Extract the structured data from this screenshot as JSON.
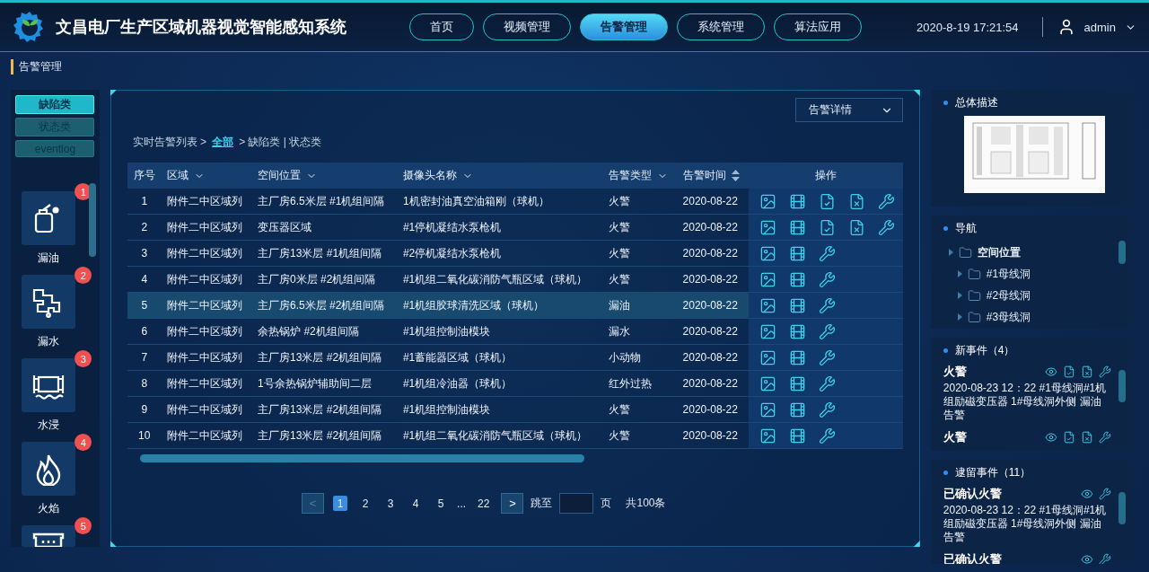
{
  "header": {
    "title": "文昌电厂生产区域机器视觉智能感知系统",
    "nav": [
      {
        "label": "首页",
        "selected": false
      },
      {
        "label": "视频管理",
        "selected": false
      },
      {
        "label": "告警管理",
        "selected": true
      },
      {
        "label": "系统管理",
        "selected": false
      },
      {
        "label": "算法应用",
        "selected": false
      }
    ],
    "datetime": "2020-8-19  17:21:54",
    "user": "admin"
  },
  "page_title": "告警管理",
  "sidebar": {
    "tabs": [
      {
        "label": "缺陷类",
        "selected": true
      },
      {
        "label": "状态类",
        "selected": false
      },
      {
        "label": "eventlog",
        "selected": false
      }
    ],
    "categories": [
      {
        "label": "漏油",
        "badge": "1"
      },
      {
        "label": "漏水",
        "badge": "2"
      },
      {
        "label": "水浸",
        "badge": "3"
      },
      {
        "label": "火焰",
        "badge": "4"
      },
      {
        "badge": "5"
      }
    ]
  },
  "main": {
    "detail_select": "告警详情",
    "breadcrumb": {
      "root": "实时告警列表 >",
      "current": "全部",
      "rest": "> 缺陷类 | 状态类"
    },
    "table": {
      "columns": [
        {
          "label": "序号",
          "kind": "plain"
        },
        {
          "label": "区域",
          "kind": "filter"
        },
        {
          "label": "空间位置",
          "kind": "filter"
        },
        {
          "label": "摄像头名称",
          "kind": "filter"
        },
        {
          "label": "告警类型",
          "kind": "filter"
        },
        {
          "label": "告警时间",
          "kind": "sort"
        },
        {
          "label": "操作",
          "kind": "plain"
        }
      ],
      "rows": [
        {
          "cells": [
            "1",
            "附件二中区域列",
            "主厂房6.5米层 #1机组间隔",
            "1机密封油真空油箱刚（球机）",
            "火警",
            "2020-08-22"
          ],
          "review_actions": true,
          "selected": false
        },
        {
          "cells": [
            "2",
            "附件二中区域列",
            "变压器区域",
            "#1停机凝结水泵枪机",
            "火警",
            "2020-08-22"
          ],
          "review_actions": true,
          "selected": false
        },
        {
          "cells": [
            "3",
            "附件二中区域列",
            "主厂房13米层 #1机组间隔",
            "#2停机凝结水泵枪机",
            "火警",
            "2020-08-22"
          ],
          "review_actions": false,
          "selected": false
        },
        {
          "cells": [
            "4",
            "附件二中区域列",
            "主厂房0米层 #2机组间隔",
            "#1机组二氧化碳消防气瓶区域（球机）",
            "火警",
            "2020-08-22"
          ],
          "review_actions": false,
          "selected": false
        },
        {
          "cells": [
            "5",
            "附件二中区域列",
            "主厂房6.5米层 #2机组间隔",
            "#1机组胶球清洗区域（球机）",
            "漏油",
            "2020-08-22"
          ],
          "review_actions": false,
          "selected": true
        },
        {
          "cells": [
            "6",
            "附件二中区域列",
            "余热锅炉 #2机组间隔",
            "#1机组控制油模块",
            "漏水",
            "2020-08-22"
          ],
          "review_actions": false,
          "selected": false
        },
        {
          "cells": [
            "7",
            "附件二中区域列",
            "主厂房13米层 #2机组间隔",
            "#1蓄能器区域（球机）",
            "小动物",
            "2020-08-22"
          ],
          "review_actions": false,
          "selected": false
        },
        {
          "cells": [
            "8",
            "附件二中区域列",
            "1号余热锅炉辅助间二层",
            "#1机组冷油器（球机）",
            "红外过热",
            "2020-08-22"
          ],
          "review_actions": false,
          "selected": false
        },
        {
          "cells": [
            "9",
            "附件二中区域列",
            "主厂房13米层 #2机组间隔",
            "#1机组控制油模块",
            "火警",
            "2020-08-22"
          ],
          "review_actions": false,
          "selected": false
        },
        {
          "cells": [
            "10",
            "附件二中区域列",
            "主厂房13米层 #2机组间隔",
            "#1机组二氧化碳消防气瓶区域（球机）",
            "火警",
            "2020-08-22"
          ],
          "review_actions": false,
          "selected": false
        }
      ]
    },
    "pagination": {
      "prev": "<",
      "pages": [
        {
          "label": "1",
          "selected": true
        },
        {
          "label": "2",
          "selected": false
        },
        {
          "label": "3",
          "selected": false
        },
        {
          "label": "4",
          "selected": false
        },
        {
          "label": "5",
          "selected": false
        }
      ],
      "ellipsis": "...",
      "last": {
        "label": "22",
        "selected": false
      },
      "next": ">",
      "jump_label": "跳至",
      "page_unit": "页",
      "total": "共100条"
    }
  },
  "right": {
    "overview": {
      "title": "总体描述"
    },
    "navigation": {
      "title": "导航",
      "tree": [
        {
          "label": "空间位置",
          "children": [
            {
              "label": "#1母线洞"
            },
            {
              "label": "#2母线洞"
            },
            {
              "label": "#3母线洞"
            }
          ]
        }
      ]
    },
    "new_events": {
      "title": "新事件（4）",
      "items": [
        {
          "title": "火警",
          "text": "2020-08-23 12：22 #1母线洞#1机组励磁变压器 1#母线洞外侧  漏油告警",
          "review_actions": true
        },
        {
          "title": "火警",
          "review_actions": true
        }
      ]
    },
    "held_events": {
      "title": "逮留事件（11）",
      "items": [
        {
          "title": "已确认火警",
          "text": "2020-08-23 12：22 #1母线洞#1机组励磁变压器 1#母线洞外侧  漏油告警",
          "review_actions": false
        },
        {
          "title": "已确认火警",
          "review_actions": false
        }
      ]
    }
  }
}
